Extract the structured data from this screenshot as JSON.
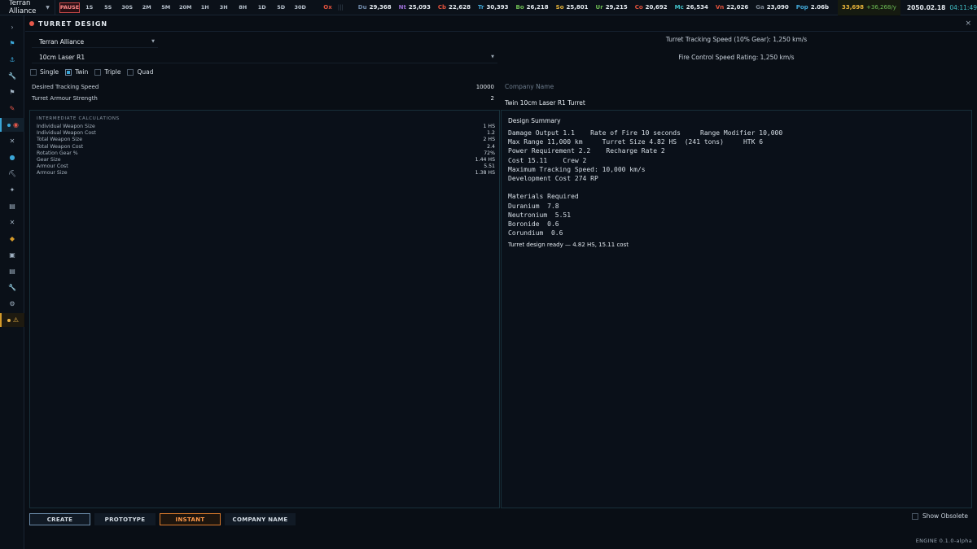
{
  "topbar": {
    "faction": "Terran Alliance",
    "pause_label": "PAUSE",
    "speeds": [
      "1S",
      "5S",
      "30S",
      "2M",
      "5M",
      "20M",
      "1H",
      "3H",
      "8H",
      "1D",
      "5D",
      "30D"
    ],
    "resources": [
      {
        "code": "Ox",
        "value": "",
        "color": "#e5533d"
      },
      {
        "code": "Du",
        "value": "29,368",
        "color": "#6f89a8"
      },
      {
        "code": "Nt",
        "value": "25,093",
        "color": "#9b6fd6"
      },
      {
        "code": "Cb",
        "value": "22,628",
        "color": "#e5533d"
      },
      {
        "code": "Tr",
        "value": "30,393",
        "color": "#42a8d8"
      },
      {
        "code": "Bo",
        "value": "26,218",
        "color": "#6fbf55"
      },
      {
        "code": "So",
        "value": "25,801",
        "color": "#e8b53a"
      },
      {
        "code": "Ur",
        "value": "29,215",
        "color": "#6fbf55"
      },
      {
        "code": "Co",
        "value": "20,692",
        "color": "#e5533d"
      },
      {
        "code": "Mc",
        "value": "26,534",
        "color": "#42c1c8"
      },
      {
        "code": "Vn",
        "value": "22,026",
        "color": "#e5533d"
      },
      {
        "code": "Ga",
        "value": "23,090",
        "color": "#7d8894"
      },
      {
        "code": "Pop",
        "value": "2.06b",
        "color": "#42a8d8"
      }
    ],
    "ox_separator": "|||",
    "wealth": "33,698",
    "wealth_rate": "+36,268/y",
    "date": "2050.02.18",
    "time": "04:11:49"
  },
  "sidebar": {
    "icons": [
      "expand-icon",
      "flag-icon",
      "anchor-icon",
      "wrench-icon",
      "marker-flag-icon",
      "rocket-icon",
      "target-icon",
      "crossed-swords-icon",
      "person-icon",
      "pickaxe-icon",
      "telescope-icon",
      "clipboard-icon",
      "crossed-swords-icon",
      "tag-icon",
      "box-icon",
      "clipboard-icon",
      "wrench-icon",
      "gear-icon",
      "warning-icon"
    ],
    "glyphs": [
      "›",
      "⚑",
      "⚓",
      "🔧",
      "⚑",
      "✎",
      "◉",
      "✕",
      "●",
      "⛏",
      "✦",
      "▤",
      "✕",
      "◆",
      "▣",
      "▤",
      "🔧",
      "⚙",
      "⚠"
    ]
  },
  "panel": {
    "title": "TURRET DESIGN",
    "close": "×",
    "empire_select": "Terran Alliance",
    "weapon_select": "10cm Laser R1",
    "tracking_speed_stat": "Turret Tracking Speed (10% Gear): 1,250 km/s",
    "fire_control_stat": "Fire Control Speed Rating: 1,250 km/s",
    "mounts": [
      {
        "label": "Single",
        "selected": false
      },
      {
        "label": "Twin",
        "selected": true
      },
      {
        "label": "Triple",
        "selected": false
      },
      {
        "label": "Quad",
        "selected": false
      }
    ],
    "fields": [
      {
        "label": "Desired Tracking Speed",
        "value": "10000"
      },
      {
        "label": "Turret Armour Strength",
        "value": "2"
      }
    ],
    "company_label": "Company Name",
    "design_name": "Twin 10cm Laser R1 Turret"
  },
  "calc": {
    "title": "INTERMEDIATE CALCULATIONS",
    "rows": [
      {
        "label": "Individual Weapon Size",
        "value": "1 HS"
      },
      {
        "label": "Individual Weapon Cost",
        "value": "1.2"
      },
      {
        "label": "Total Weapon Size",
        "value": "2 HS"
      },
      {
        "label": "Total Weapon Cost",
        "value": "2.4"
      },
      {
        "label": "Rotation Gear %",
        "value": "72%"
      },
      {
        "label": "Gear Size",
        "value": "1.44 HS"
      },
      {
        "label": "Armour Cost",
        "value": "5.51"
      },
      {
        "label": "Armour Size",
        "value": "1.38 HS"
      }
    ]
  },
  "summary": {
    "title": "Design Summary",
    "lines": [
      "Damage Output 1.1    Rate of Fire 10 seconds     Range Modifier 10,000",
      "Max Range 11,000 km     Turret Size 4.82 HS  (241 tons)     HTK 6",
      "Power Requirement 2.2    Recharge Rate 2",
      "Cost 15.11    Crew 2",
      "Maximum Tracking Speed: 10,000 km/s",
      "Development Cost 274 RP",
      "",
      "Materials Required",
      "Duranium  7.8",
      "Neutronium  5.51",
      "Boronide  0.6",
      "Corundium  0.6"
    ],
    "status": "Turret design ready — 4.82 HS, 15.11 cost"
  },
  "actions": {
    "create": "CREATE",
    "prototype": "PROTOTYPE",
    "instant": "INSTANT",
    "company_name": "COMPANY NAME",
    "show_obsolete": "Show Obsolete"
  },
  "footer": {
    "engine": "ENGINE  0.1.0-alpha"
  }
}
